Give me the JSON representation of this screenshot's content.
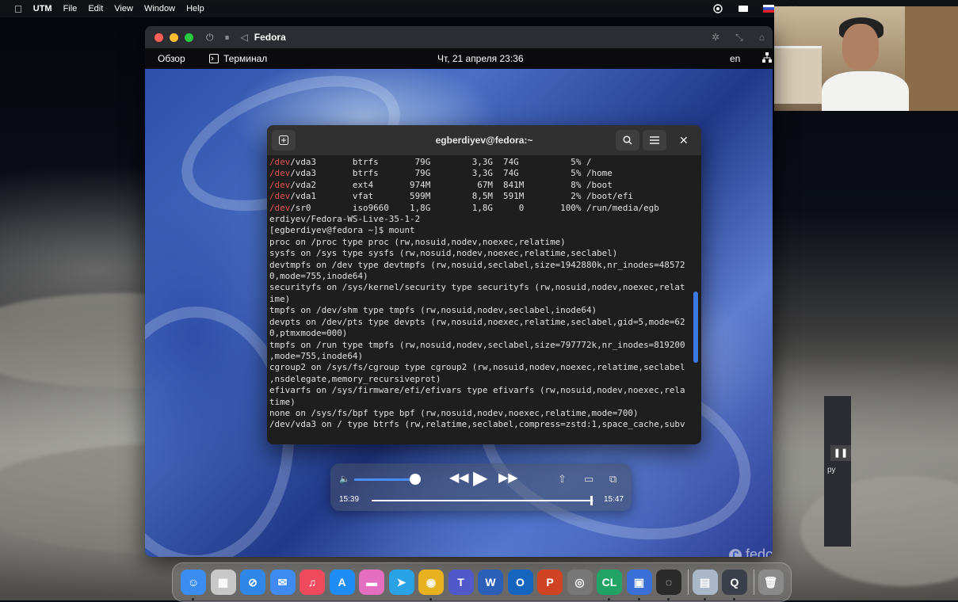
{
  "menubar": {
    "apple_icon": "apple-icon",
    "app": "UTM",
    "items": [
      "File",
      "Edit",
      "View",
      "Window",
      "Help"
    ]
  },
  "utm_window": {
    "title": "Fedora",
    "controls": [
      "⏻",
      "⏸",
      "◁"
    ]
  },
  "gnome_bar": {
    "activities": "Обзор",
    "app_name": "Терминал",
    "clock": "Чт, 21 апреля  23:36",
    "language": "en"
  },
  "terminal": {
    "title": "egberdiyev@fedora:~",
    "lines": [
      {
        "red": "/dev",
        "text": "/vda3       btrfs       79G        3,3G  74G          5% /"
      },
      {
        "red": "/dev",
        "text": "/vda3       btrfs       79G        3,3G  74G          5% /home"
      },
      {
        "red": "/dev",
        "text": "/vda2       ext4       974M         67M  841M         8% /boot"
      },
      {
        "red": "/dev",
        "text": "/vda1       vfat       599M        8,5M  591M         2% /boot/efi"
      },
      {
        "red": "/dev",
        "text": "/sr0        iso9660    1,8G        1,8G     0       100% /run/media/egb"
      },
      {
        "red": "",
        "text": "erdiyev/Fedora-WS-Live-35-1-2"
      },
      {
        "red": "",
        "text": "[egberdiyev@fedora ~]$ mount"
      },
      {
        "red": "",
        "text": "proc on /proc type proc (rw,nosuid,nodev,noexec,relatime)"
      },
      {
        "red": "",
        "text": "sysfs on /sys type sysfs (rw,nosuid,nodev,noexec,relatime,seclabel)"
      },
      {
        "red": "",
        "text": "devtmpfs on /dev type devtmpfs (rw,nosuid,seclabel,size=1942880k,nr_inodes=48572"
      },
      {
        "red": "",
        "text": "0,mode=755,inode64)"
      },
      {
        "red": "",
        "text": "securityfs on /sys/kernel/security type securityfs (rw,nosuid,nodev,noexec,relat"
      },
      {
        "red": "",
        "text": "ime)"
      },
      {
        "red": "",
        "text": "tmpfs on /dev/shm type tmpfs (rw,nosuid,nodev,seclabel,inode64)"
      },
      {
        "red": "",
        "text": "devpts on /dev/pts type devpts (rw,nosuid,noexec,relatime,seclabel,gid=5,mode=62"
      },
      {
        "red": "",
        "text": "0,ptmxmode=000)"
      },
      {
        "red": "",
        "text": "tmpfs on /run type tmpfs (rw,nosuid,nodev,seclabel,size=797772k,nr_inodes=819200"
      },
      {
        "red": "",
        "text": ",mode=755,inode64)"
      },
      {
        "red": "",
        "text": "cgroup2 on /sys/fs/cgroup type cgroup2 (rw,nosuid,nodev,noexec,relatime,seclabel"
      },
      {
        "red": "",
        "text": ",nsdelegate,memory_recursiveprot)"
      },
      {
        "red": "",
        "text": "efivarfs on /sys/firmware/efi/efivars type efivarfs (rw,nosuid,nodev,noexec,rela"
      },
      {
        "red": "",
        "text": "time)"
      },
      {
        "red": "",
        "text": "none on /sys/fs/bpf type bpf (rw,nosuid,nodev,noexec,relatime,mode=700)"
      },
      {
        "red": "",
        "text": "/dev/vda3 on / type btrfs (rw,relatime,seclabel,compress=zstd:1,space_cache,subv"
      }
    ]
  },
  "player": {
    "elapsed": "15:39",
    "remaining": "15:47",
    "volume_fraction": 0.95,
    "progress_fraction": 0.99
  },
  "desktop": {
    "fedora_logo": "fedora",
    "bg_window_label": "ру"
  },
  "dock": {
    "apps": [
      {
        "name": "finder",
        "color": "#3b8ef0",
        "glyph": "☺"
      },
      {
        "name": "launchpad",
        "color": "#c8c8c8",
        "glyph": "▦"
      },
      {
        "name": "safari",
        "color": "#2f88e8",
        "glyph": "⊘"
      },
      {
        "name": "mail",
        "color": "#3f8bf2",
        "glyph": "✉"
      },
      {
        "name": "music",
        "color": "#f04a5e",
        "glyph": "♫"
      },
      {
        "name": "app-store",
        "color": "#1f8df5",
        "glyph": "A"
      },
      {
        "name": "flow",
        "color": "#e46fc0",
        "glyph": "▬"
      },
      {
        "name": "telegram",
        "color": "#2aa3e6",
        "glyph": "➤"
      },
      {
        "name": "chrome",
        "color": "#e8b21f",
        "glyph": "◉"
      },
      {
        "name": "teams",
        "color": "#5059c9",
        "glyph": "T"
      },
      {
        "name": "word",
        "color": "#2b5fb8",
        "glyph": "W"
      },
      {
        "name": "outlook",
        "color": "#1565c0",
        "glyph": "O"
      },
      {
        "name": "powerpoint",
        "color": "#d04423",
        "glyph": "P"
      },
      {
        "name": "dvd-player",
        "color": "#777777",
        "glyph": "◎"
      },
      {
        "name": "clion",
        "color": "#21a366",
        "glyph": "CL"
      },
      {
        "name": "utm",
        "color": "#3a6fd8",
        "glyph": "▣"
      },
      {
        "name": "obs",
        "color": "#2a2a2a",
        "glyph": "◌"
      },
      {
        "name": "preview",
        "color": "#a9b7c8",
        "glyph": "▤"
      },
      {
        "name": "quicktime",
        "color": "#3a3f4a",
        "glyph": "Q"
      },
      {
        "name": "trash",
        "color": "#8a8a8a",
        "glyph": "🗑"
      }
    ]
  }
}
